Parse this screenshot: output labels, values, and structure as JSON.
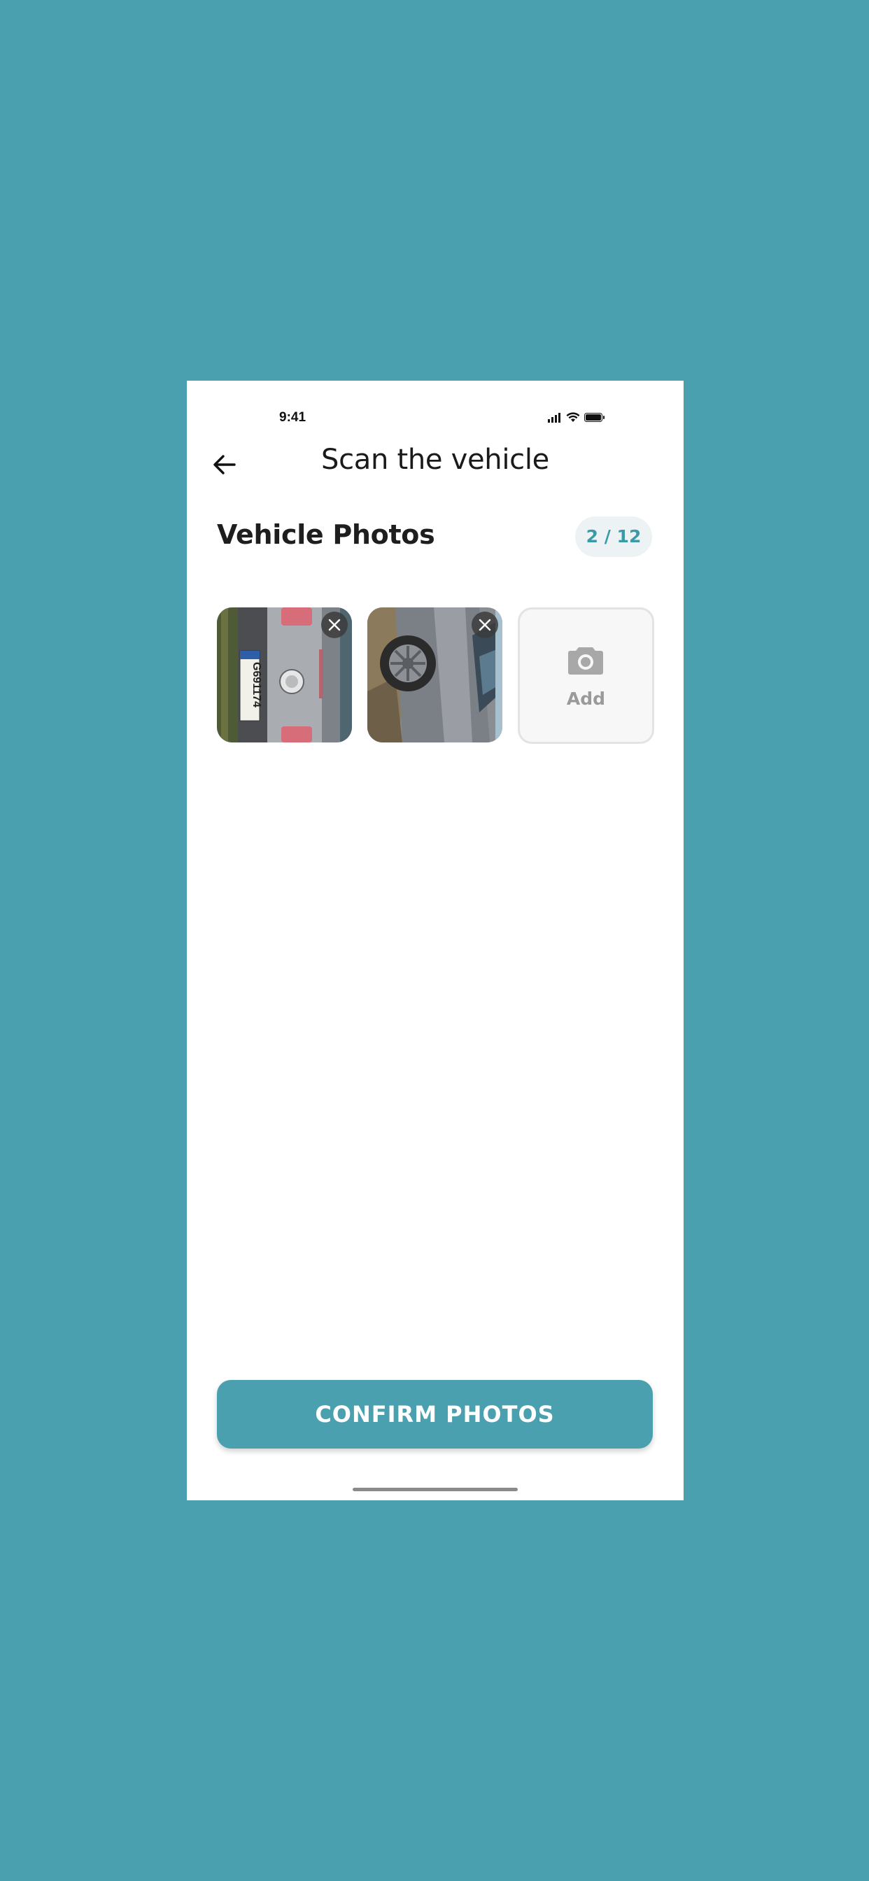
{
  "status_bar": {
    "time": "9:41"
  },
  "header": {
    "title": "Scan the vehicle"
  },
  "section": {
    "title": "Vehicle Photos",
    "count": "2 / 12",
    "photos_taken": 2,
    "photos_max": 12
  },
  "photos": [
    {
      "name": "photo-rear-plate",
      "plate": "G691174"
    },
    {
      "name": "photo-side-wheel"
    }
  ],
  "add_tile": {
    "label": "Add",
    "icon": "camera-icon"
  },
  "confirm": {
    "label": "CONFIRM PHOTOS"
  },
  "colors": {
    "background": "#4aa0ae",
    "accent": "#4aa0ae",
    "badge_bg": "#edf3f4",
    "badge_text": "#3a9aa7"
  }
}
